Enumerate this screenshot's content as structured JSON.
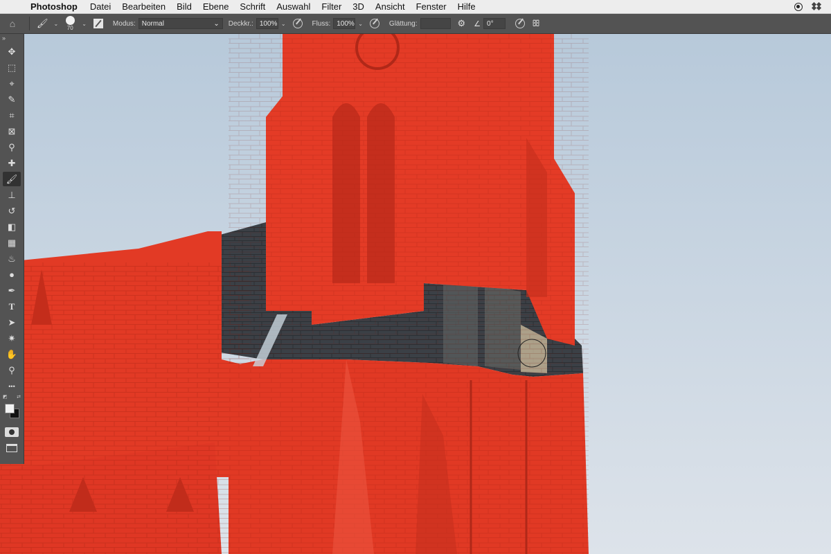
{
  "menubar": {
    "apple": "",
    "app_name": "Photoshop",
    "items": [
      "Datei",
      "Bearbeiten",
      "Bild",
      "Ebene",
      "Schrift",
      "Auswahl",
      "Filter",
      "3D",
      "Ansicht",
      "Fenster",
      "Hilfe"
    ]
  },
  "options_bar": {
    "brush_size": "70",
    "modus_label": "Modus:",
    "modus_value": "Normal",
    "deckkraft_label": "Deckkr.:",
    "deckkraft_value": "100%",
    "fluss_label": "Fluss:",
    "fluss_value": "100%",
    "glaettung_label": "Glättung:",
    "glaettung_value": "",
    "angle_value": "0°"
  },
  "toolbar": {
    "collapse": "»",
    "tools": [
      {
        "name": "move-tool",
        "glyph": "✥"
      },
      {
        "name": "marquee-tool",
        "glyph": "⬚"
      },
      {
        "name": "lasso-tool",
        "glyph": "⌖"
      },
      {
        "name": "quick-selection-tool",
        "glyph": "✎"
      },
      {
        "name": "crop-tool",
        "glyph": "⌗"
      },
      {
        "name": "frame-tool",
        "glyph": "⊠"
      },
      {
        "name": "eyedropper-tool",
        "glyph": "⚲"
      },
      {
        "name": "healing-brush-tool",
        "glyph": "✚"
      },
      {
        "name": "brush-tool",
        "glyph": "🖌"
      },
      {
        "name": "clone-stamp-tool",
        "glyph": "⊥"
      },
      {
        "name": "history-brush-tool",
        "glyph": "↺"
      },
      {
        "name": "eraser-tool",
        "glyph": "◧"
      },
      {
        "name": "gradient-tool",
        "glyph": "▦"
      },
      {
        "name": "blur-tool",
        "glyph": "♨"
      },
      {
        "name": "dodge-tool",
        "glyph": "●"
      },
      {
        "name": "pen-tool",
        "glyph": "✒"
      },
      {
        "name": "type-tool",
        "glyph": "T"
      },
      {
        "name": "path-selection-tool",
        "glyph": "➤"
      },
      {
        "name": "custom-shape-tool",
        "glyph": "✷"
      },
      {
        "name": "hand-tool",
        "glyph": "✋"
      },
      {
        "name": "zoom-tool",
        "glyph": "⚲"
      },
      {
        "name": "more-tools",
        "glyph": "•••"
      }
    ],
    "active_tool": "brush-tool"
  },
  "colors": {
    "foreground": "#f2f2f2",
    "background": "#111111",
    "quick_mask_overlay": "#e23a25",
    "sky": "#c6d3df"
  }
}
